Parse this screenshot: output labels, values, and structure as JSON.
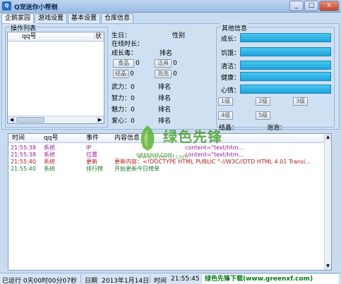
{
  "window": {
    "title": "Q宠迷你小帮侧",
    "icon_label": "Q",
    "min": "_",
    "max": "□",
    "close": "×"
  },
  "tabs": [
    "企鹅家园",
    "游戏设置",
    "基本设置",
    "仓库信息"
  ],
  "operations": {
    "title": "操作列表",
    "columns": [
      "qq号",
      "状"
    ]
  },
  "pet": {
    "birthday": "生日：",
    "gender": "性别",
    "online_time": "在线时长：",
    "growth": "成长毒：",
    "rank1": "排名",
    "food_btn": "食品",
    "food_val": "0",
    "clean_btn": "洁具",
    "clean_val": "0",
    "crystal_btn": "结晶",
    "crystal_val": "0",
    "bubble_btn": "泡泡",
    "bubble_val": "0",
    "stats": [
      {
        "label": "武力：0",
        "rank": "排名"
      },
      {
        "label": "智力：0",
        "rank": "排名"
      },
      {
        "label": "魅力：0",
        "rank": "排名"
      },
      {
        "label": "爱心：0",
        "rank": "排名"
      }
    ]
  },
  "other": {
    "title": "其他信息",
    "bars": [
      {
        "label": "成长：",
        "level": 1
      },
      {
        "label": "饥饿：",
        "level": 1
      },
      {
        "label": "清洁：",
        "level": 1
      },
      {
        "label": "健康：",
        "level": 1
      },
      {
        "label": "心情：",
        "level": 1
      }
    ],
    "levels": [
      "1级",
      "2级",
      "3级",
      "4级",
      "5级"
    ],
    "crystal": "结晶：",
    "bubble": "泡泡："
  },
  "log": {
    "headers": [
      "时间",
      "qq号",
      "事件",
      "内容信息"
    ],
    "rows": [
      {
        "time": "21:55:38",
        "qq": "系统",
        "event": "IP",
        "content": "content=\"text/htm...",
        "color": "#9a1a9a"
      },
      {
        "time": "21:55:38",
        "qq": "系统",
        "event": "位置",
        "content": "content=\"text/htm...",
        "color": "#9a1a9a"
      },
      {
        "time": "21:55:40",
        "qq": "系统",
        "event": "更新",
        "content": "更新内容：<!DOCTYPE HTML PUBLIC \"-//W3C//DTD HTML 4.01 Transi...",
        "color": "#b01818"
      },
      {
        "time": "21:55:40",
        "qq": "系统",
        "event": "排行榜",
        "content": "开始更新今日榜单",
        "color": "#1a7a2a"
      }
    ]
  },
  "status": {
    "running": "已运行 0天00时00分07秒",
    "date_label": "日期",
    "date": "2013年1月14日",
    "time_label": "时间",
    "time": "21:55:45",
    "banner": "绿色先锋下载(www.greenxf.com)"
  },
  "watermark": {
    "brand": "绿色先锋",
    "logo_text": "GREENXF.COM",
    "url": "www.greenxf.com"
  },
  "colors": {
    "bar": "#1fa3db",
    "brand_green": "#4aa033"
  }
}
